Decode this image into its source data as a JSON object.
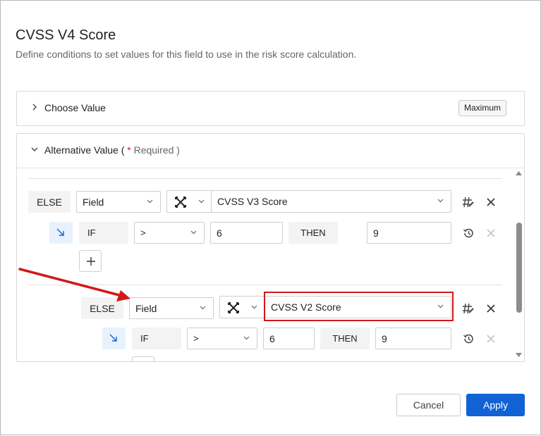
{
  "dialog": {
    "title": "CVSS V4 Score",
    "subtitle": "Define conditions to set values for this field to use in the risk score calculation."
  },
  "choose_value": {
    "label": "Choose Value",
    "badge": "Maximum"
  },
  "alternative_value": {
    "label": "Alternative Value (",
    "required_star": "*",
    "required_text": " Required )"
  },
  "rule1": {
    "else_label": "ELSE",
    "source_select": "Field",
    "field_select": "CVSS V3 Score",
    "condition": {
      "if_label": "IF",
      "operator": ">",
      "value": "6",
      "then_label": "THEN",
      "result": "9"
    },
    "add_label": "+"
  },
  "rule2": {
    "else_label": "ELSE",
    "source_select": "Field",
    "field_select": "CVSS V2 Score",
    "condition": {
      "if_label": "IF",
      "operator": ">",
      "value": "6",
      "then_label": "THEN",
      "result": "9"
    }
  },
  "icons": {
    "function": "crossed-arrows-icon",
    "indent": "arrow-down-right-icon",
    "row_action": "hash-edit-icon",
    "remove": "close-icon",
    "history": "history-icon"
  },
  "footer": {
    "cancel": "Cancel",
    "apply": "Apply"
  },
  "colors": {
    "primary": "#1262d6",
    "highlight": "#d0191a",
    "indent_bg": "#e8f2fc"
  }
}
